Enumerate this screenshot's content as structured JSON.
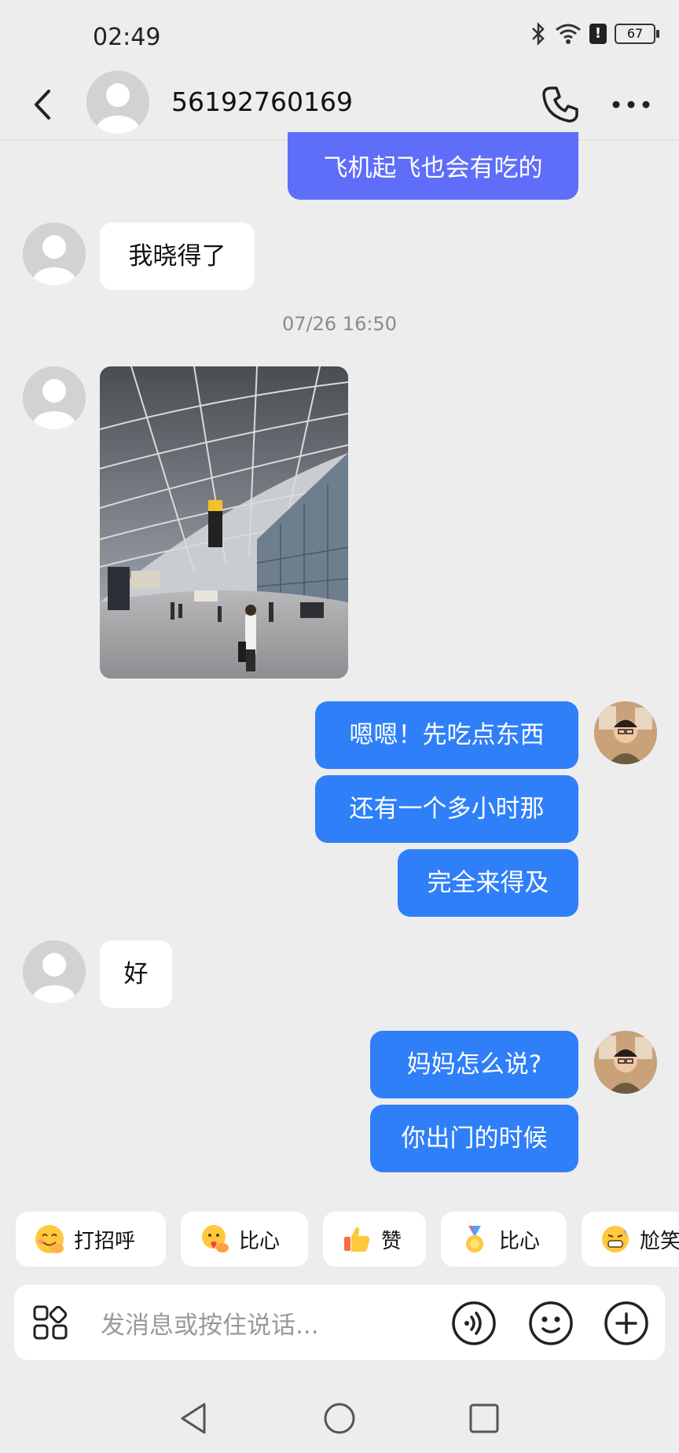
{
  "status_bar": {
    "time": "02:49",
    "battery": "67"
  },
  "header": {
    "contact_name": "56192760169"
  },
  "messages": [
    {
      "side": "out",
      "text": "飞机起飞也会有吃的"
    },
    {
      "side": "in",
      "text": "我晓得了"
    },
    {
      "type": "timestamp",
      "text": "07/26 16:50"
    },
    {
      "side": "in",
      "type": "image",
      "caption": "airport-terminal-photo"
    },
    {
      "side": "out",
      "text": "嗯嗯！先吃点东西"
    },
    {
      "side": "out",
      "text": "还有一个多小时那"
    },
    {
      "side": "out",
      "text": "完全来得及"
    },
    {
      "side": "in",
      "text": "好"
    },
    {
      "side": "out",
      "text": "妈妈怎么说?"
    },
    {
      "side": "out",
      "text": "你出门的时候"
    }
  ],
  "quick_replies": [
    {
      "emoji": "smiling-hand-emoji",
      "label": "打招呼"
    },
    {
      "emoji": "heart-hands-emoji",
      "label": "比心"
    },
    {
      "emoji": "thumbs-up-emoji",
      "label": "赞"
    },
    {
      "emoji": "medal-emoji",
      "label": "比心"
    },
    {
      "emoji": "awkward-laugh-emoji",
      "label": "尬笑"
    }
  ],
  "input": {
    "placeholder": "发消息或按住说话..."
  },
  "colors": {
    "outgoing": "#2f7ff8",
    "outgoing_first": "#5f6ef8",
    "background": "#ededed"
  }
}
